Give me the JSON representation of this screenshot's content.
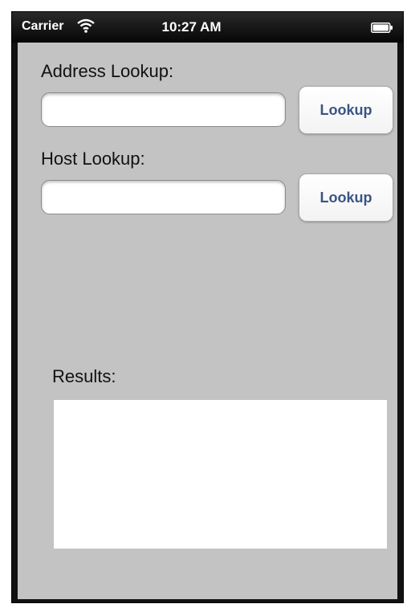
{
  "status_bar": {
    "carrier": "Carrier",
    "time": "10:27 AM",
    "wifi_icon": "wifi-icon",
    "battery_icon": "battery-icon"
  },
  "address_lookup": {
    "label": "Address Lookup:",
    "value": "",
    "button_label": "Lookup"
  },
  "host_lookup": {
    "label": "Host Lookup:",
    "value": "",
    "button_label": "Lookup"
  },
  "results": {
    "label": "Results:",
    "content": ""
  },
  "colors": {
    "background": "#c3c3c3",
    "button_text": "#3a5584",
    "status_bar": "#111111"
  }
}
